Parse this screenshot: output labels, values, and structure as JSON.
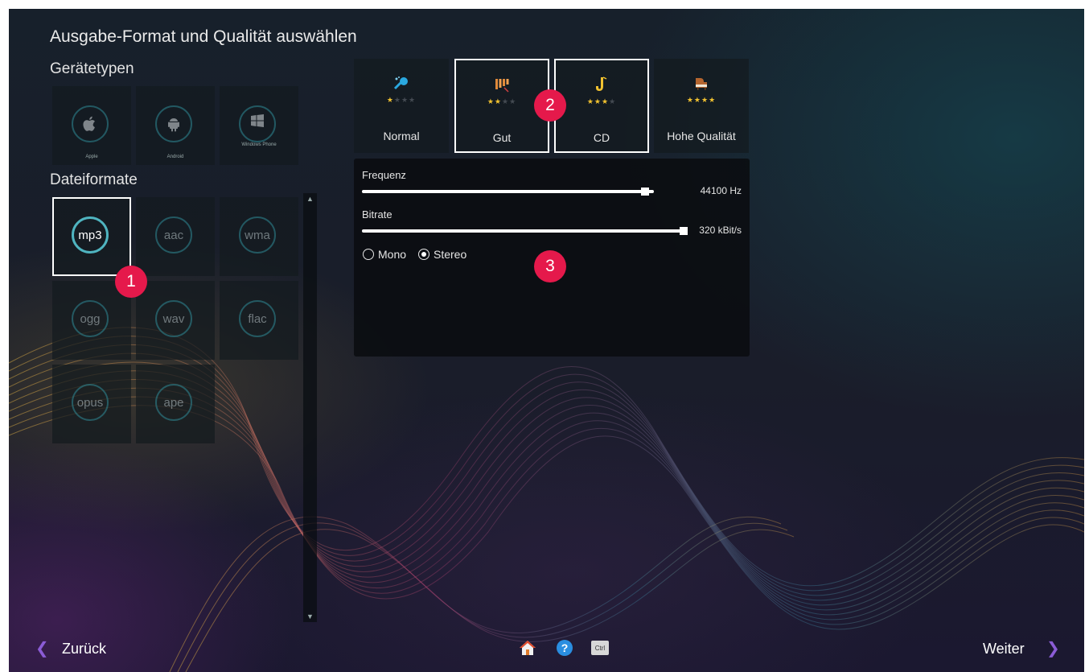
{
  "header": {
    "title": "Ausgabe-Format und Qualität auswählen"
  },
  "device_types": {
    "label": "Gerätetypen",
    "items": [
      {
        "name": "Apple",
        "icon": "apple-icon"
      },
      {
        "name": "Android",
        "icon": "android-icon"
      },
      {
        "name": "Windows Phone",
        "icon": "windows-icon"
      }
    ]
  },
  "file_formats": {
    "label": "Dateiformate",
    "selected": "mp3",
    "items": [
      "mp3",
      "aac",
      "wma",
      "ogg",
      "wav",
      "flac",
      "opus",
      "ape"
    ]
  },
  "quality_presets": {
    "items": [
      {
        "label": "Normal",
        "stars": 1,
        "icon": "microphone-icon"
      },
      {
        "label": "Gut",
        "stars": 2,
        "icon": "xylophone-icon"
      },
      {
        "label": "CD",
        "stars": 3,
        "icon": "saxophone-icon"
      },
      {
        "label": "Hohe Qualität",
        "stars": 4,
        "icon": "piano-icon"
      }
    ]
  },
  "settings": {
    "frequency": {
      "label": "Frequenz",
      "value_text": "44100 Hz",
      "fraction": 0.97
    },
    "bitrate": {
      "label": "Bitrate",
      "value_text": "320 kBit/s",
      "fraction": 1.0
    },
    "channels": {
      "mono_label": "Mono",
      "stereo_label": "Stereo",
      "selected": "Stereo"
    }
  },
  "badges": {
    "one": "1",
    "two": "2",
    "three": "3"
  },
  "footer": {
    "back_label": "Zurück",
    "next_label": "Weiter",
    "ctrl_label": "Ctrl",
    "help_label": "?"
  },
  "colors": {
    "accent_circle": "#2f8b97",
    "badge": "#e5194b",
    "nav_chevron": "#8b5cd6",
    "star": "#f2c230"
  }
}
